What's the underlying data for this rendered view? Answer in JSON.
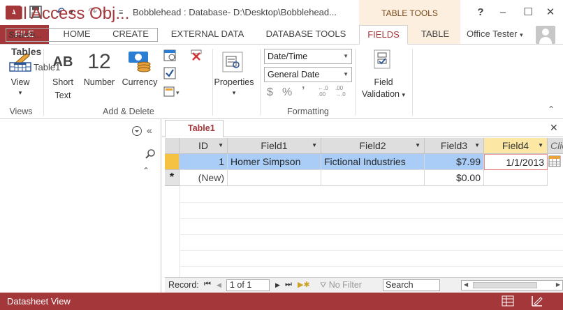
{
  "app": {
    "logo_text": "A",
    "title": "Bobblehead : Database- D:\\Desktop\\Bobblehead...",
    "context_tools": "TABLE TOOLS",
    "user": "Office Tester",
    "window_buttons": {
      "help": "?",
      "minimize": "–",
      "maximize": "☐",
      "close": "✕"
    }
  },
  "tabs": {
    "file": "FILE",
    "home": "HOME",
    "create": "CREATE",
    "external": "EXTERNAL DATA",
    "dbtools": "DATABASE TOOLS",
    "fields": "FIELDS",
    "table": "TABLE"
  },
  "ribbon": {
    "view": "View",
    "short_text_icon": "AB",
    "short_text_1": "Short",
    "short_text_2": "Text",
    "number_icon": "12",
    "number": "Number",
    "currency": "Currency",
    "views_group": "Views",
    "add_delete_group": "Add & Delete",
    "properties": "Properties",
    "format_type": "Date/Time",
    "format_style": "General Date",
    "currency_sym": "$",
    "percent_sym": "%",
    "comma_sym": "ʼ",
    "inc_dec_1": "←.0",
    "inc_dec_1b": ".00",
    "inc_dec_2": ".00",
    "inc_dec_2b": "→.0",
    "formatting_group": "Formatting",
    "field_validation_1": "Field",
    "field_validation_2": "Validation"
  },
  "nav": {
    "title": "All Access Obj...",
    "search_placeholder": "Search...",
    "section": "Tables",
    "items": [
      "Table1"
    ]
  },
  "document": {
    "tab": "Table1"
  },
  "grid": {
    "columns": [
      "ID",
      "Field1",
      "Field2",
      "Field3",
      "Field4",
      "Clic"
    ],
    "rows": [
      {
        "id": "1",
        "field1": "Homer Simpson",
        "field2": "Fictional Industries",
        "field3": "$7.99",
        "field4": "1/1/2013"
      },
      {
        "id": "(New)",
        "field1": "",
        "field2": "",
        "field3": "$0.00",
        "field4": ""
      }
    ],
    "new_row_marker": "*"
  },
  "record_nav": {
    "label": "Record:",
    "position": "1 of 1",
    "filter": "No Filter",
    "search": "Search"
  },
  "status": {
    "text": "Datasheet View"
  }
}
